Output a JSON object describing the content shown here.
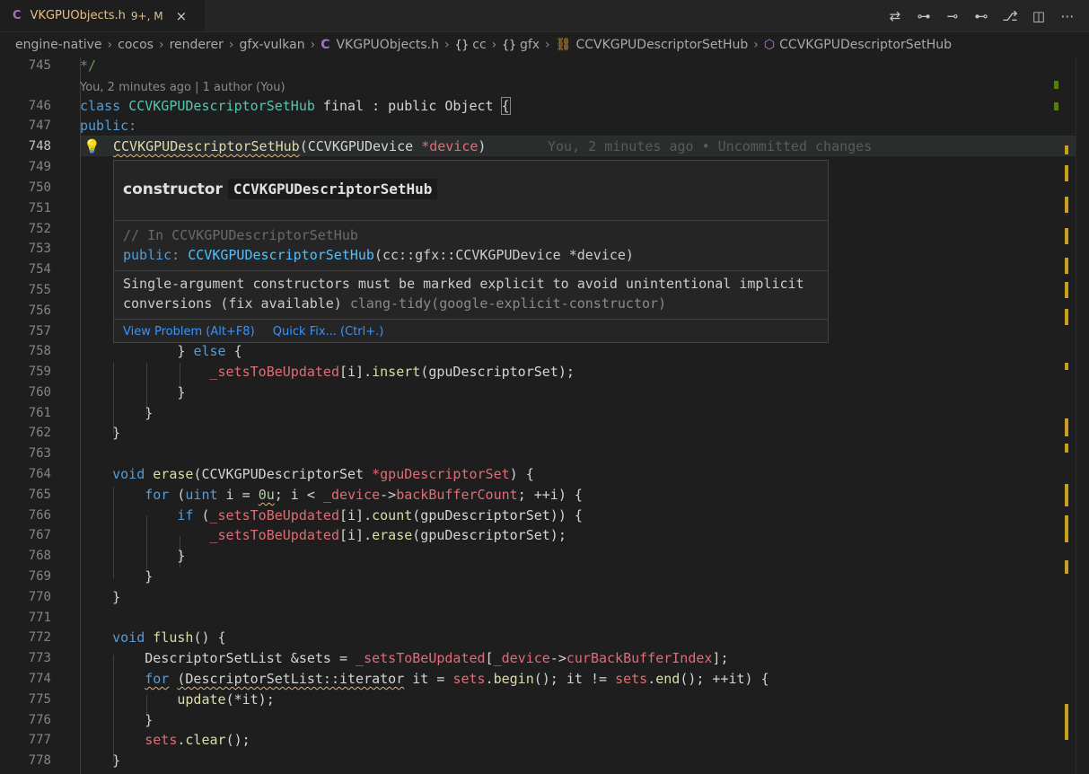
{
  "tab": {
    "filename": "VKGPUObjects.h",
    "badge": "9+, M",
    "file_icon": "C",
    "close": "×"
  },
  "actions": [
    {
      "name": "compare-changes-icon",
      "glyph": "⇄"
    },
    {
      "name": "previous-change-icon",
      "glyph": "⊶"
    },
    {
      "name": "commit-icon",
      "glyph": "⊸"
    },
    {
      "name": "next-change-icon",
      "glyph": "⊷"
    },
    {
      "name": "git-graph-icon",
      "glyph": "⎇"
    },
    {
      "name": "split-editor-icon",
      "glyph": "◫"
    },
    {
      "name": "more-actions-icon",
      "glyph": "⋯"
    }
  ],
  "breadcrumb": {
    "items": [
      "engine-native",
      "cocos",
      "renderer",
      "gfx-vulkan",
      "VKGPUObjects.h",
      "cc",
      "gfx",
      "CCVKGPUDescriptorSetHub",
      "CCVKGPUDescriptorSetHub"
    ],
    "braces": "{}",
    "file_icon": "C"
  },
  "editor": {
    "line_numbers": [
      "745",
      "746",
      "747",
      "748",
      "749",
      "750",
      "751",
      "752",
      "753",
      "754",
      "755",
      "756",
      "757",
      "758",
      "759",
      "760",
      "761",
      "762",
      "763",
      "764",
      "765",
      "766",
      "767",
      "768",
      "769",
      "770",
      "771",
      "772",
      "773",
      "774",
      "775",
      "776",
      "777",
      "778"
    ],
    "blame_header": "You, 2 minutes ago | 1 author (You)",
    "inline_blame": "You, 2 minutes ago • Uncommitted changes",
    "lines": {
      "l745": "*/",
      "l746_class": "class ",
      "l746_name": "CCVKGPUDescriptorSetHub",
      "l746_rest": " final : public Object ",
      "l747": "public:",
      "l748_fn": "CCVKGPUDescriptorSetHub",
      "l748_rest": "(CCVKGPUDevice ",
      "l748_param": "*device",
      "l748_close": ")"
    }
  },
  "hover": {
    "kind": "constructor",
    "name": "CCVKGPUDescriptorSetHub",
    "comment": "// In CCVKGPUDescriptorSetHub",
    "sig_kw": "public:",
    "sig_fn": "CCVKGPUDescriptorSetHub",
    "sig_rest": "(cc::gfx::CCVKGPUDevice *device)",
    "msg1": "Single-argument constructors must be marked explicit to avoid unintentional implicit",
    "msg2": "conversions (fix available)",
    "source": "clang-tidy(google-explicit-constructor)",
    "view_problem": "View Problem (Alt+F8)",
    "quick_fix": "Quick Fix... (Ctrl+.)"
  }
}
